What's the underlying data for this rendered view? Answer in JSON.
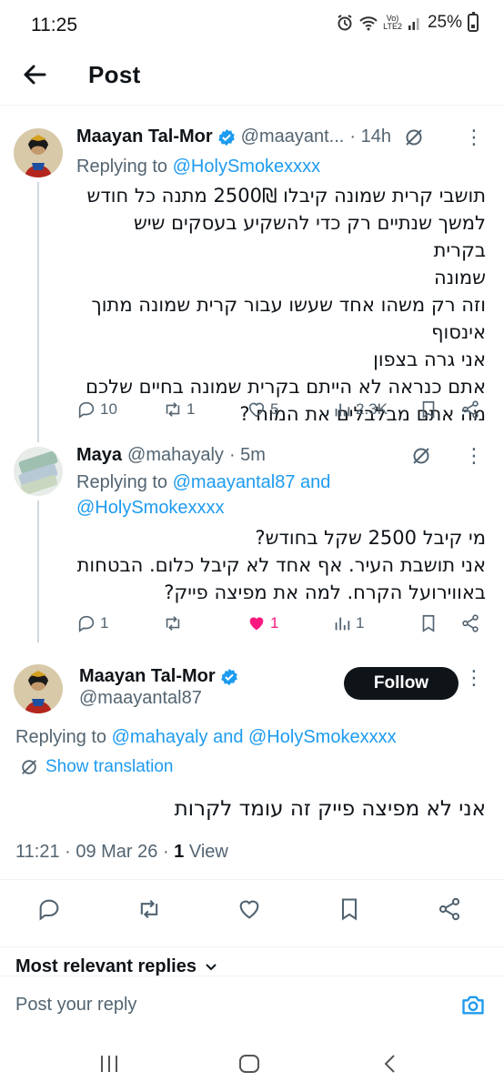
{
  "status": {
    "time": "11:25",
    "network": "LTE2",
    "signal_label": "Vo)",
    "battery": "25%"
  },
  "header": {
    "title": "Post"
  },
  "tweets": [
    {
      "name": "Maayan Tal-Mor",
      "handle": "@maayant...",
      "time": "· 14h",
      "replying_label": "Replying to",
      "replying_to": "@HolySmokexxxx",
      "body": [
        "תושבי קרית שמונה קיבלו 2500₪ מתנה כל חודש",
        "למשך שנתיים רק כדי להשקיע בעסקים שיש בקרית",
        "שמונה",
        "וזה רק משהו אחד שעשו עבור קרית שמונה מתוך",
        "אינסוף",
        "אני גרה בצפון",
        "אתם כנראה לא הייתם בקרית שמונה בחיים שלכם",
        "מה אתם מבלבלים את המוח ?"
      ],
      "stats": {
        "replies": "10",
        "reposts": "1",
        "likes": "5",
        "views": "2.3K"
      }
    },
    {
      "name": "Maya",
      "handle": "@mahayaly",
      "time": "· 5m",
      "replying_label": "Replying to",
      "replying_to": "@maayantal87 and",
      "replying_to_2": "@HolySmokexxxx",
      "body": [
        "מי קיבל 2500 שקל בחודש?",
        "אני תושבת העיר. אף אחד לא קיבל כלום. הבטחות",
        "באווירועל הקרח. למה את מפיצה פייק?"
      ],
      "stats": {
        "replies": "1",
        "reposts": "",
        "likes": "1",
        "views": "1"
      }
    }
  ],
  "main_post": {
    "name": "Maayan Tal-Mor",
    "handle": "@maayantal87",
    "follow_label": "Follow",
    "replying_label": "Replying to",
    "replying_to": "@mahayaly and @HolySmokexxxx",
    "show_translation": "Show translation",
    "body": "אני לא מפיצה פייק זה עומד לקרות",
    "timestamp": "11:21 · 09 Mar 26 · ",
    "views_count": "1",
    "views_label": " View"
  },
  "replies_filter": "Most relevant replies",
  "reply_box": {
    "placeholder": "Post your reply"
  },
  "colors": {
    "accent": "#1d9bf0",
    "like": "#f91880",
    "text": "#0f1419",
    "muted": "#536471"
  }
}
